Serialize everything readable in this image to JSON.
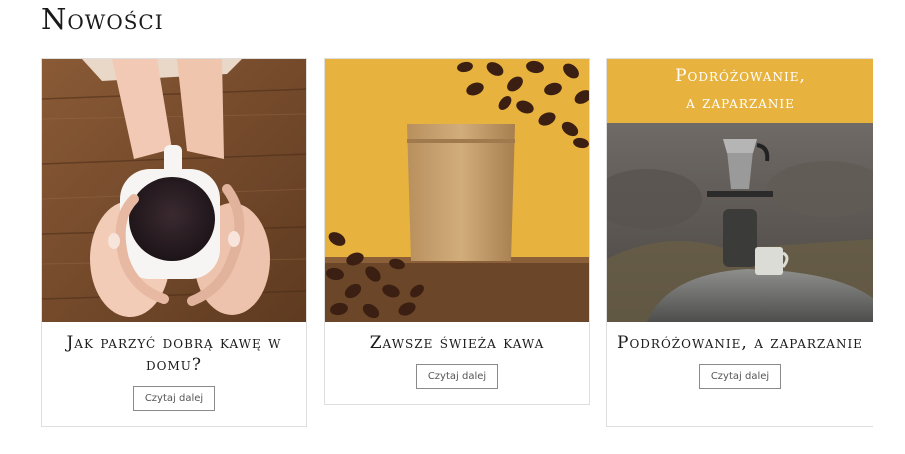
{
  "section": {
    "title": "Nowości"
  },
  "posts": [
    {
      "title": "Jak parzyć dobrą kawę w domu?",
      "button": "Czytaj dalej",
      "image": "coffee-cup-hands-image"
    },
    {
      "title": "Zawsze świeża kawa",
      "button": "Czytaj dalej",
      "image": "coffee-bag-beans-image"
    },
    {
      "title": "Podróżowanie, a zaparzanie",
      "button": "Czytaj dalej",
      "image": "camping-moka-pot-image",
      "image_overlay": {
        "line1": "Podróżowanie,",
        "line2": "a zaparzanie"
      }
    }
  ],
  "colors": {
    "accent_yellow": "#E8B23E",
    "wood": "#7A4E2D",
    "border": "#DEDEDE"
  }
}
